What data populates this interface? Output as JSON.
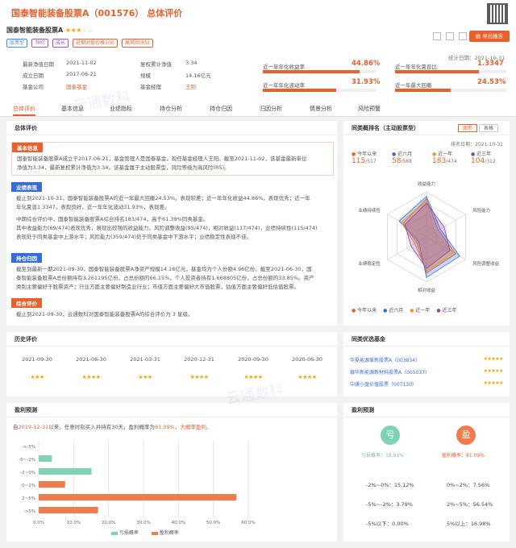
{
  "header": {
    "title": "国泰智能装备股票A（001576） 总体评价",
    "fund_name": "国泰智能装备股票A",
    "tags": [
      "股票型",
      "TMT",
      "成长",
      "近期对股价格100",
      "高风险(R5)"
    ],
    "export_label": "导出报告"
  },
  "info": {
    "rows": [
      {
        "k1": "最新净值日期",
        "v1": "2021-11-02",
        "k2": "复权累计净值",
        "v2": "3.34"
      },
      {
        "k1": "成立日期",
        "v1": "2017-06-21",
        "k2": "规模",
        "v2": "14.16亿元"
      },
      {
        "k1": "基金公司",
        "v1": "国泰基金",
        "k2": "基金经理",
        "v2": "王阳"
      }
    ],
    "stat_date": "统计日期：2021-10-31",
    "metrics": [
      {
        "label": "近一年年化收益率",
        "value": "44.86%",
        "pct": 0.86,
        "color": "#e8602c"
      },
      {
        "label": "近一年年化夏普比",
        "value": "1.3347",
        "pct": 0.75,
        "color": "#e8602c"
      },
      {
        "label": "近一年年化波动率",
        "value": "31.93%",
        "pct": 0.65,
        "color": "#e8602c"
      },
      {
        "label": "近一年最大回撤",
        "value": "24.53%",
        "pct": 0.5,
        "color": "#e8602c"
      }
    ]
  },
  "tabs": [
    "总体评价",
    "基本信息",
    "业绩指标",
    "持仓分析",
    "持仓归因",
    "归因分析",
    "情景分析",
    "风险预警"
  ],
  "overall": {
    "title": "总体评价",
    "sections": [
      {
        "head": "基本信息",
        "color": "#e8602c",
        "lines": [
          "国泰智能装备股票A成立于2017-06-21，基金管理人是国泰基金，现任基金经理人王阳。截至2021-11-02，该基金最新单位",
          "净值为3.34，最新复权累计净值为3.34。该基金属于主动股票型，风险等级为高风险(R5)。"
        ]
      },
      {
        "head": "业绩表现",
        "color": "#3a6bd6",
        "lines": [
          "截止到2021-10-31，国泰智能装备股票A的近一年最大回撤24.53%，表现较差；近一年年化收益44.86%，表现优秀；近一年",
          "年化夏普1.3347，表现良好，近一年年化波动31.93%，表现差。",
          "中期综合评价中，国泰智能装备股票A综合排名183/474，高于61.39%同类基金。",
          "其中收益能力(69/474)表现优秀，展现出较强的收益能力，风险调整收益(95/474)，相对收益(117/474)，业绩持续性(115/474)",
          "表现处于同类基金中上游水平；风险能力(359/474)处于同类基金中下游水平；业绩稳定性表现不佳。"
        ]
      },
      {
        "head": "持仓归因",
        "color": "#3a6bd6",
        "lines": [
          "截至到最新一期2021-09-30，国泰智能装备股票A净资产规模14.16亿元，基金均为个人份额4.96亿份。截至2021-06-30，国",
          "泰智能装备股票A总份额持有3.261195亿份，占总份额的66.15%，个人投资者持有1.668805亿份，占总份额的33.85%。资产",
          "类别主要偏好于股票资产；行业方面主要偏好制造业行业；市值方面主要偏好大市值股票，估值方面主要偏好低估值股票。"
        ]
      },
      {
        "head": "综合评价",
        "color": "#e8602c",
        "lines": [
          "截止到2021-09-30，云通数科对国泰智能装备股票A的综合评价为 3 星级。"
        ]
      }
    ]
  },
  "peer": {
    "title": "同类概排名（主动股票型）",
    "toggle": [
      "图形",
      "表格"
    ],
    "date": "排名日期：2021-10-31",
    "ranks": [
      {
        "label": "今年以来",
        "rank": "115",
        "total": "/517",
        "color": "#e8602c"
      },
      {
        "label": "近六月",
        "rank": "58",
        "total": "/588",
        "color": "#3a6bd6"
      },
      {
        "label": "近一年",
        "rank": "183",
        "total": "/474",
        "color": "#e89b2c"
      },
      {
        "label": "近三年",
        "rank": "104",
        "total": "/312",
        "color": "#8e44ad"
      }
    ],
    "axes": [
      "收益能力",
      "风险能力",
      "风险调整收益",
      "相对收益",
      "业绩稳定性",
      "业绩持续性"
    ],
    "legend": [
      "今年以来",
      "近六月",
      "近一年",
      "近三年"
    ]
  },
  "radar": {
    "series": [
      {
        "name": "今年以来",
        "color": "#e8602c",
        "values": [
          0.85,
          0.3,
          0.75,
          0.8,
          0.25,
          0.6
        ]
      },
      {
        "name": "近六月",
        "color": "#3a6bd6",
        "values": [
          0.9,
          0.35,
          0.85,
          0.9,
          0.2,
          0.7
        ]
      },
      {
        "name": "近一年",
        "color": "#e89b2c",
        "values": [
          0.8,
          0.2,
          0.7,
          0.75,
          0.3,
          0.65
        ]
      },
      {
        "name": "近三年",
        "color": "#8e44ad",
        "values": [
          0.75,
          0.45,
          0.6,
          0.7,
          0.4,
          0.55
        ]
      }
    ]
  },
  "history": {
    "title": "历史评价",
    "items": [
      {
        "date": "2021-09-30",
        "stars": "★★★"
      },
      {
        "date": "2021-06-30",
        "stars": "★★★★"
      },
      {
        "date": "2021-03-31",
        "stars": "★★★"
      },
      {
        "date": "2020-12-31",
        "stars": "★★★★"
      },
      {
        "date": "2020-09-30",
        "stars": "★★★★"
      },
      {
        "date": "2020-06-30",
        "stars": "★★★★"
      }
    ]
  },
  "similar": {
    "title": "同类优选基金",
    "items": [
      {
        "name": "华夏能源革新股票A（003834）",
        "stars": "★★★★★"
      },
      {
        "name": "银华新能源新材料股票A（005037）",
        "stars": "★★★★★"
      },
      {
        "name": "中庚小盘价值股票（007130）",
        "stars": "★★★★★"
      }
    ]
  },
  "profit": {
    "title": "盈利预测",
    "desc_pre": "自",
    "desc_date": "2019-12-31",
    "desc_mid": "以来，任意时刻买入并持有30天，盈利概率为",
    "desc_pct": "81.09%",
    "desc_end": "，大概率盈利。",
    "legend_loss": "亏损概率",
    "legend_gain": "盈利概率"
  },
  "chart_data": {
    "type": "bar",
    "orientation": "horizontal",
    "categories": [
      "<-5%",
      "-5~-2%",
      "-2~0%",
      "0~2%",
      "2~5%",
      ">5%"
    ],
    "series": [
      {
        "name": "亏损概率",
        "color": "#7fd3b4",
        "values": [
          0.0,
          3.79,
          15.12,
          0,
          0,
          0
        ]
      },
      {
        "name": "盈利概率",
        "color": "#f07b50",
        "values": [
          0,
          0,
          0,
          7.56,
          56.54,
          16.98
        ]
      }
    ],
    "xticks": [
      "0.0%",
      "10.0%",
      "20.0%",
      "30.0%",
      "40.0%",
      "50.0%",
      "60.0%"
    ],
    "xlim": [
      0,
      60
    ],
    "grid": true
  },
  "prob": {
    "title": "盈利预测",
    "loss_icon": "亏",
    "gain_icon": "盈",
    "loss_label": "亏损概率：",
    "loss_value": "18.91%",
    "gain_label": "盈利概率：",
    "gain_value": "81.09%",
    "rows": [
      {
        "l": "-2%~0%：",
        "lv": "15.12%",
        "r": "0%~2%：",
        "rv": "7.56%"
      },
      {
        "l": "-5%~-2%：",
        "lv": "3.79%",
        "r": "2%~5%：",
        "rv": "56.54%"
      },
      {
        "l": "-5%以下：",
        "lv": "0.00%",
        "r": "5%以上：",
        "rv": "16.98%"
      }
    ]
  },
  "watermark": "云通数科"
}
